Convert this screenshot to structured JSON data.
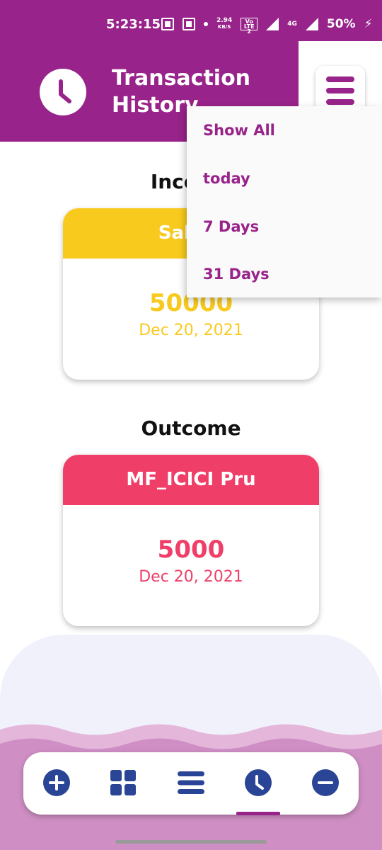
{
  "status_bar": {
    "time": "5:23:15",
    "net_speed": "2.94",
    "net_speed_unit": "KB/S",
    "volte": "Vo LTE 2",
    "network": "4G",
    "battery": "50%"
  },
  "header": {
    "title": "Transaction History",
    "icon": "clock-icon",
    "menu_icon": "hamburger-menu-icon"
  },
  "dropdown": {
    "items": [
      "Show All",
      "today",
      "7 Days",
      "31 Days"
    ]
  },
  "income": {
    "section_title": "Income",
    "card": {
      "name": "Salary",
      "amount": "50000",
      "date": "Dec 20, 2021"
    }
  },
  "outcome": {
    "section_title": "Outcome",
    "card": {
      "name": "MF_ICICI Pru",
      "amount": "5000",
      "date": "Dec 20, 2021"
    }
  },
  "bottom_nav": {
    "items": [
      "add-icon",
      "grid-icon",
      "list-icon",
      "clock-icon",
      "minus-icon"
    ],
    "active_index": 3
  },
  "colors": {
    "primary": "#98238a",
    "income": "#f8ca1e",
    "outcome": "#ef3f68",
    "nav_icon": "#2a4496"
  }
}
